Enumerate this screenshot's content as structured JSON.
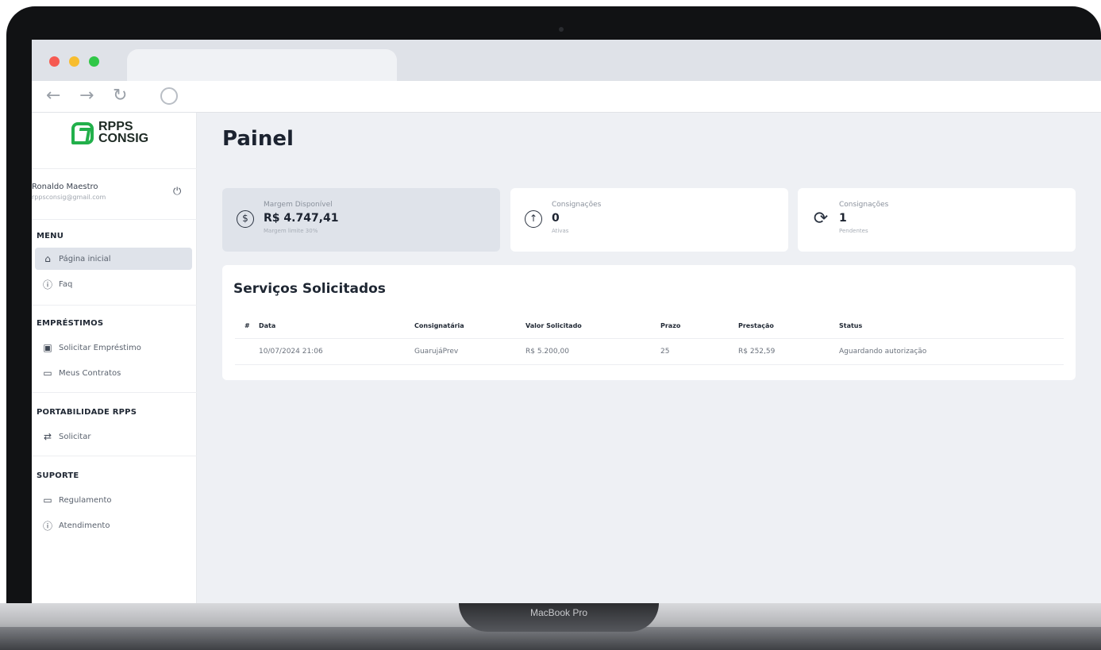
{
  "device": {
    "label": "MacBook Pro"
  },
  "brand": {
    "line1": "RPPS",
    "line2": "CONSIG",
    "accent": "#22b04b"
  },
  "user": {
    "name": "Ronaldo Maestro",
    "email": "rppsconsig@gmail.com"
  },
  "sidebar": {
    "menu_title": "MENU",
    "menu_items": [
      {
        "label": "Página inicial",
        "icon": "home-icon",
        "active": true
      },
      {
        "label": "Faq",
        "icon": "info-icon",
        "active": false
      }
    ],
    "emprestimos_title": "EMPRÉSTIMOS",
    "emprestimos_items": [
      {
        "label": "Solicitar Empréstimo",
        "icon": "wallet-icon"
      },
      {
        "label": "Meus Contratos",
        "icon": "folder-icon"
      }
    ],
    "portabilidade_title": "PORTABILIDADE RPPS",
    "portabilidade_items": [
      {
        "label": "Solicitar",
        "icon": "transfer-icon"
      }
    ],
    "suporte_title": "SUPORTE",
    "suporte_items": [
      {
        "label": "Regulamento",
        "icon": "folder-icon"
      },
      {
        "label": "Atendimento",
        "icon": "info-icon"
      }
    ]
  },
  "main": {
    "title": "Painel",
    "cards": [
      {
        "label": "Margem Disponível",
        "value": "R$ 4.747,41",
        "sub": "Margem limite 30%",
        "icon": "dollar-icon"
      },
      {
        "label": "Consignações",
        "value": "0",
        "sub": "Ativas",
        "icon": "arrow-up-icon"
      },
      {
        "label": "Consignações",
        "value": "1",
        "sub": "Pendentes",
        "icon": "refresh-icon"
      }
    ],
    "services": {
      "title": "Serviços Solicitados",
      "columns": [
        "#",
        "Data",
        "Consignatária",
        "Valor Solicitado",
        "Prazo",
        "Prestação",
        "Status"
      ],
      "rows": [
        [
          "",
          "10/07/2024 21:06",
          "GuarujáPrev",
          "R$ 5.200,00",
          "25",
          "R$ 252,59",
          "Aguardando autorização"
        ]
      ]
    }
  }
}
